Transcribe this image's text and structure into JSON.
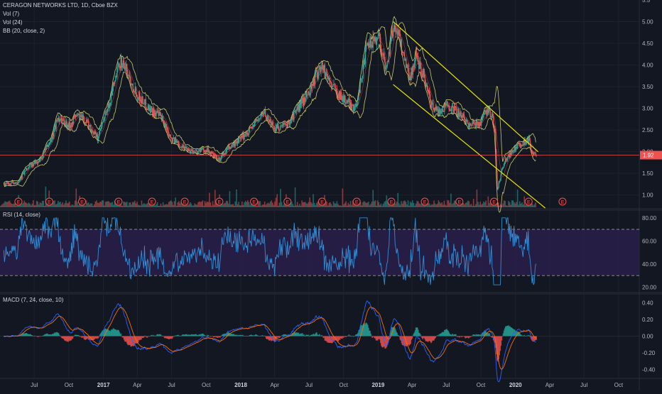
{
  "symbol_title": "CERAGON NETWORKS LTD, 1D, Cboe BZX",
  "indicators": {
    "vol7": "Vol (7)",
    "vol24": "Vol (24)",
    "bb": "BB (20, close, 2)",
    "rsi": "RSI (14, close)",
    "macd": "MACD (7, 24, close, 10)"
  },
  "last_price_label": "1.92",
  "earnings_marker": "E",
  "colors": {
    "background": "#131722",
    "grid": "#1e222d",
    "up": "#26a69a",
    "down": "#ef5350",
    "bollinger": "#c8c86a",
    "channel": "#e6e600",
    "price_line": "#ef5350",
    "rsi_line": "#2f8fd8",
    "rsi_band": "#2a1f4a",
    "macd_line": "#2962ff",
    "signal_line": "#ff6d00"
  },
  "chart_data": [
    {
      "type": "candlestick",
      "title": "CERAGON NETWORKS LTD, 1D, Cboe BZX",
      "x_ticks": [
        "Jul",
        "Oct",
        "2017",
        "Apr",
        "Jul",
        "Oct",
        "2018",
        "Apr",
        "Jul",
        "Oct",
        "2019",
        "Apr",
        "Jul",
        "Oct",
        "2020",
        "Apr",
        "Jul",
        "Oct"
      ],
      "y_ticks": [
        "5.5",
        "5.00",
        "4.50",
        "4.00",
        "3.50",
        "3.00",
        "2.50",
        "2.00",
        "1.50",
        "1.00"
      ],
      "ylim": [
        0.7,
        5.5
      ],
      "last_price": 1.92,
      "close_series": [
        [
          "2016-04-15",
          1.25
        ],
        [
          "2016-05-15",
          1.3
        ],
        [
          "2016-06-15",
          1.65
        ],
        [
          "2016-07-15",
          1.8
        ],
        [
          "2016-08-15",
          2.3
        ],
        [
          "2016-09-01",
          2.8
        ],
        [
          "2016-10-01",
          2.6
        ],
        [
          "2016-10-20",
          2.85
        ],
        [
          "2016-11-15",
          2.7
        ],
        [
          "2016-12-15",
          2.3
        ],
        [
          "2017-01-15",
          3.1
        ],
        [
          "2017-02-01",
          3.7
        ],
        [
          "2017-02-15",
          4.1
        ],
        [
          "2017-03-01",
          3.9
        ],
        [
          "2017-03-15",
          3.6
        ],
        [
          "2017-04-01",
          3.3
        ],
        [
          "2017-05-01",
          3.0
        ],
        [
          "2017-06-01",
          2.8
        ],
        [
          "2017-07-01",
          2.3
        ],
        [
          "2017-08-01",
          2.1
        ],
        [
          "2017-09-01",
          2.0
        ],
        [
          "2017-10-01",
          2.05
        ],
        [
          "2017-11-01",
          1.8
        ],
        [
          "2017-12-01",
          2.1
        ],
        [
          "2018-01-01",
          2.3
        ],
        [
          "2018-02-01",
          2.6
        ],
        [
          "2018-03-01",
          2.9
        ],
        [
          "2018-04-01",
          2.55
        ],
        [
          "2018-05-01",
          2.6
        ],
        [
          "2018-06-01",
          3.0
        ],
        [
          "2018-07-01",
          3.4
        ],
        [
          "2018-08-01",
          4.0
        ],
        [
          "2018-09-01",
          3.5
        ],
        [
          "2018-10-01",
          3.2
        ],
        [
          "2018-11-01",
          3.0
        ],
        [
          "2018-12-01",
          4.4
        ],
        [
          "2019-01-01",
          4.7
        ],
        [
          "2019-01-20",
          3.9
        ],
        [
          "2019-02-10",
          4.9
        ],
        [
          "2019-02-20",
          4.8
        ],
        [
          "2019-03-10",
          4.2
        ],
        [
          "2019-03-25",
          3.7
        ],
        [
          "2019-04-10",
          4.2
        ],
        [
          "2019-05-01",
          3.8
        ],
        [
          "2019-05-20",
          3.1
        ],
        [
          "2019-06-10",
          2.9
        ],
        [
          "2019-07-01",
          3.1
        ],
        [
          "2019-08-01",
          2.9
        ],
        [
          "2019-09-01",
          2.6
        ],
        [
          "2019-10-01",
          2.7
        ],
        [
          "2019-10-20",
          3.0
        ],
        [
          "2019-11-05",
          2.6
        ],
        [
          "2019-11-12",
          1.1
        ],
        [
          "2019-11-25",
          1.6
        ],
        [
          "2019-12-10",
          1.9
        ],
        [
          "2020-01-01",
          2.1
        ],
        [
          "2020-01-20",
          2.2
        ],
        [
          "2020-02-05",
          2.3
        ],
        [
          "2020-02-15",
          1.92
        ]
      ],
      "trend_channel": {
        "upper": [
          [
            "2019-02-10",
            5.0
          ],
          [
            "2020-03-01",
            2.0
          ]
        ],
        "lower": [
          [
            "2019-02-10",
            3.55
          ],
          [
            "2020-03-20",
            0.7
          ]
        ]
      },
      "earnings_dates": [
        "2016-05-20",
        "2016-08-10",
        "2016-11-05",
        "2017-02-10",
        "2017-05-10",
        "2017-08-05",
        "2017-11-05",
        "2018-02-05",
        "2018-05-05",
        "2018-08-05",
        "2018-11-05",
        "2019-02-05",
        "2019-05-05",
        "2019-08-05",
        "2019-11-05",
        "2020-02-05",
        "2020-05-05"
      ]
    },
    {
      "type": "line",
      "title": "RSI (14, close)",
      "y_ticks": [
        "80.00",
        "60.00",
        "40.00",
        "20.00"
      ],
      "ylim": [
        16,
        86
      ],
      "band": [
        30,
        70
      ]
    },
    {
      "type": "line",
      "title": "MACD (7, 24, close, 10)",
      "y_ticks": [
        "0.40",
        "0.20",
        "0.00",
        "-0.20",
        "-0.40"
      ],
      "ylim": [
        -0.5,
        0.5
      ]
    }
  ]
}
